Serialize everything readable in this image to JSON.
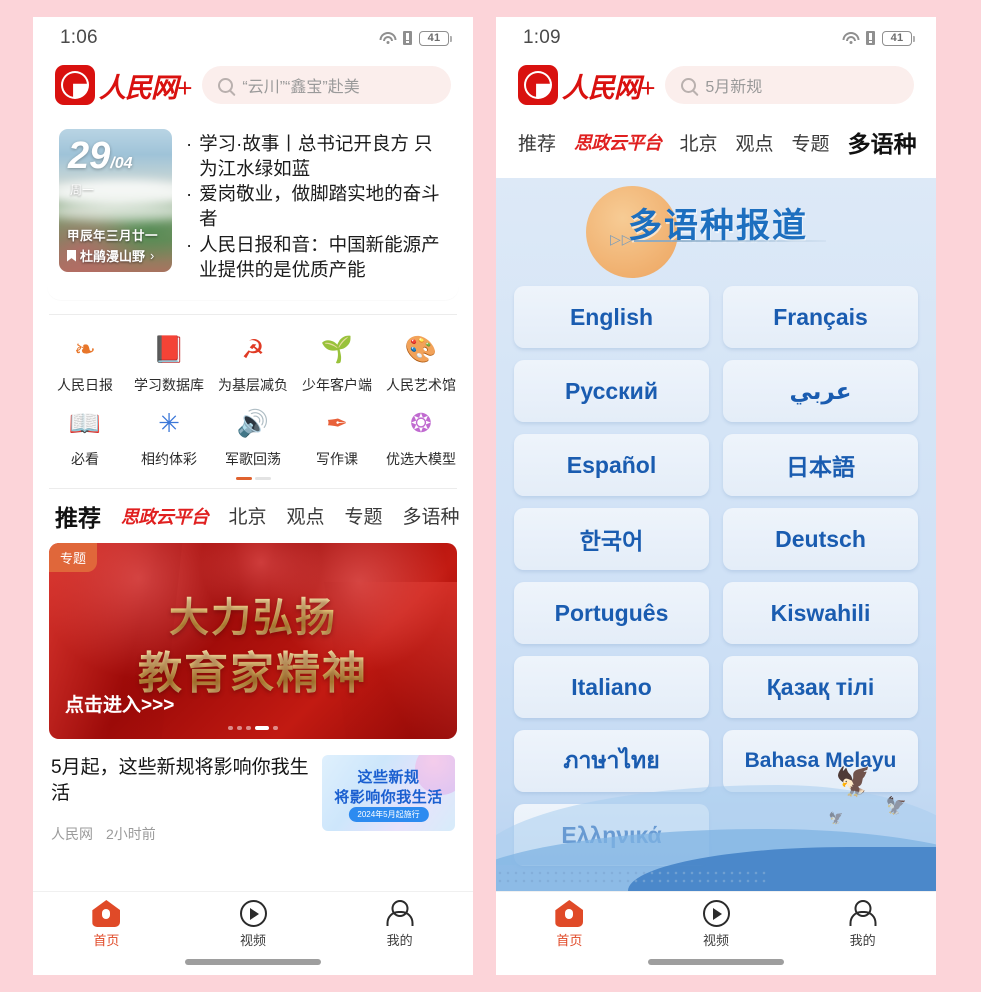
{
  "theme": {
    "background": "#fcd4d9",
    "brand_red": "#d9110f",
    "accent_orange": "#e04a28",
    "lang_blue": "#1a5cb0"
  },
  "left_phone": {
    "status": {
      "time": "1:06",
      "battery": "41",
      "wifi_icon": "wifi-icon",
      "sim_icon": "sim-card-icon"
    },
    "header": {
      "logo_text": "人民网+",
      "search_placeholder": "“云川”“鑫宝”赴美",
      "search_icon": "search-icon"
    },
    "calendar": {
      "day": "29",
      "month": "/04",
      "weekday": "周一",
      "lunar": "甲辰年三月廿一",
      "caption": "杜鹃漫山野",
      "arrow": "›"
    },
    "headlines": [
      "学习·故事丨总书记开良方 只为江水绿如蓝",
      "爱岗敬业，做脚踏实地的奋斗者",
      "人民日报和音：中国新能源产业提供的是优质产能"
    ],
    "shortcuts": [
      {
        "label": "人民日报",
        "icon": "ribbon-icon",
        "glyph": "❧",
        "color": "#e8762a"
      },
      {
        "label": "学习数据库",
        "icon": "book-star-icon",
        "glyph": "📕",
        "color": "#ef8a3a"
      },
      {
        "label": "为基层减负",
        "icon": "party-emblem-icon",
        "glyph": "☭",
        "color": "#e03a24"
      },
      {
        "label": "少年客户端",
        "icon": "sprout-icon",
        "glyph": "🌱",
        "color": "#7ab648"
      },
      {
        "label": "人民艺术馆",
        "icon": "art-gallery-icon",
        "glyph": "🎨",
        "color": "#e0662c"
      },
      {
        "label": "必看",
        "icon": "open-book-icon",
        "glyph": "📖",
        "color": "#ef8a3a"
      },
      {
        "label": "相约体彩",
        "icon": "sports-lottery-icon",
        "glyph": "✳",
        "color": "#3b77d8"
      },
      {
        "label": "军歌回荡",
        "icon": "audio-wave-icon",
        "glyph": "🔊",
        "color": "#f0893b"
      },
      {
        "label": "写作课",
        "icon": "pen-nib-icon",
        "glyph": "✒",
        "color": "#e8613a"
      },
      {
        "label": "优选大模型",
        "icon": "ai-model-icon",
        "glyph": "❂",
        "color": "#c06ad0"
      }
    ],
    "pager": {
      "pages": 2,
      "active": 0
    },
    "channel_tabs": [
      {
        "label": "推荐",
        "state": "active"
      },
      {
        "label": "思政云平台",
        "state": "badge"
      },
      {
        "label": "北京",
        "state": "normal"
      },
      {
        "label": "观点",
        "state": "normal"
      },
      {
        "label": "专题",
        "state": "normal"
      },
      {
        "label": "多语种",
        "state": "normal"
      }
    ],
    "banner": {
      "tag": "专题",
      "line1": "大力弘扬",
      "line2": "教育家精神",
      "cta": "点击进入>>>",
      "dots": 5,
      "active_dot": 3
    },
    "feed_item": {
      "title": "5月起，这些新规将影响你我生活",
      "source": "人民网",
      "time": "2小时前",
      "thumb_line1": "这些新规",
      "thumb_line2": "将影响你我生活",
      "thumb_pill": "2024年5月起施行"
    },
    "bottom_nav": [
      {
        "label": "首页",
        "icon": "home-icon",
        "active": true
      },
      {
        "label": "视频",
        "icon": "play-circle-icon",
        "active": false
      },
      {
        "label": "我的",
        "icon": "user-icon",
        "active": false
      }
    ]
  },
  "right_phone": {
    "status": {
      "time": "1:09",
      "battery": "41",
      "wifi_icon": "wifi-icon",
      "sim_icon": "sim-card-icon"
    },
    "header": {
      "logo_text": "人民网+",
      "search_placeholder": "5月新规",
      "search_icon": "search-icon"
    },
    "channel_tabs": [
      {
        "label": "推荐",
        "state": "normal"
      },
      {
        "label": "思政云平台",
        "state": "badge"
      },
      {
        "label": "北京",
        "state": "normal"
      },
      {
        "label": "观点",
        "state": "normal"
      },
      {
        "label": "专题",
        "state": "normal"
      },
      {
        "label": "多语种",
        "state": "active"
      }
    ],
    "page": {
      "title": "多语种报道",
      "arrows": "▷▷"
    },
    "languages": [
      {
        "label": "English",
        "rtl": false
      },
      {
        "label": "Français",
        "rtl": false
      },
      {
        "label": "Русский",
        "rtl": false
      },
      {
        "label": "عربي",
        "rtl": true
      },
      {
        "label": "Español",
        "rtl": false
      },
      {
        "label": "日本語",
        "rtl": false
      },
      {
        "label": "한국어",
        "rtl": false
      },
      {
        "label": "Deutsch",
        "rtl": false
      },
      {
        "label": "Português",
        "rtl": false
      },
      {
        "label": "Kiswahili",
        "rtl": false
      },
      {
        "label": "Italiano",
        "rtl": false
      },
      {
        "label": "Қазақ тілі",
        "rtl": false
      },
      {
        "label": "ภาษาไทย",
        "rtl": false
      },
      {
        "label": "Bahasa Melayu",
        "rtl": false
      },
      {
        "label": "Ελληνικά",
        "rtl": false
      }
    ],
    "bottom_nav": [
      {
        "label": "首页",
        "icon": "home-icon",
        "active": true
      },
      {
        "label": "视频",
        "icon": "play-circle-icon",
        "active": false
      },
      {
        "label": "我的",
        "icon": "user-icon",
        "active": false
      }
    ]
  }
}
